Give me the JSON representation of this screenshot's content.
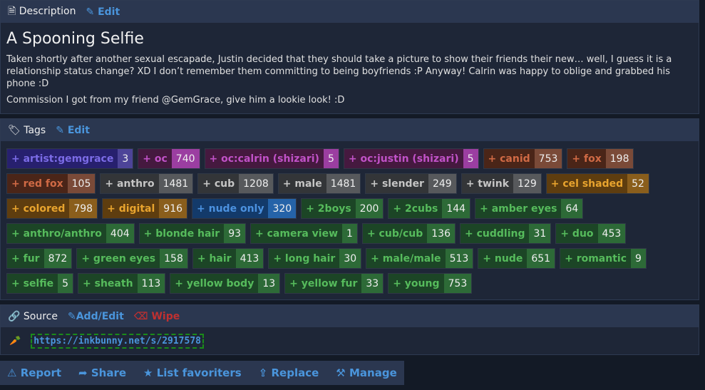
{
  "description": {
    "header": "Description",
    "edit": "Edit",
    "title": "A Spooning Selfie",
    "paragraphs": [
      "Taken shortly after another sexual escapade, Justin decided that they should take a picture to show their friends their new… well, I guess it is a relationship status change? XD I don’t remember them committing to being boyfriends :P Anyway! Calrin was happy to oblige and grabbed his phone :D",
      "Commission I got from my friend @GemGrace, give him a lookie look! :D"
    ]
  },
  "tags": {
    "header": "Tags",
    "edit": "Edit",
    "items": [
      {
        "name": "+ artist:gemgrace",
        "count": "3",
        "type": "artist"
      },
      {
        "name": "+ oc",
        "count": "740",
        "type": "character"
      },
      {
        "name": "+ oc:calrin (shizari)",
        "count": "5",
        "type": "character"
      },
      {
        "name": "+ oc:justin (shizari)",
        "count": "5",
        "type": "character"
      },
      {
        "name": "+ canid",
        "count": "753",
        "type": "species"
      },
      {
        "name": "+ fox",
        "count": "198",
        "type": "species"
      },
      {
        "name": "+ red fox",
        "count": "105",
        "type": "species"
      },
      {
        "name": "+ anthro",
        "count": "1481",
        "type": "general"
      },
      {
        "name": "+ cub",
        "count": "1208",
        "type": "general"
      },
      {
        "name": "+ male",
        "count": "1481",
        "type": "general"
      },
      {
        "name": "+ slender",
        "count": "249",
        "type": "general"
      },
      {
        "name": "+ twink",
        "count": "129",
        "type": "general"
      },
      {
        "name": "+ cel shaded",
        "count": "52",
        "type": "meta"
      },
      {
        "name": "+ colored",
        "count": "798",
        "type": "meta"
      },
      {
        "name": "+ digital",
        "count": "916",
        "type": "meta"
      },
      {
        "name": "+ nude only",
        "count": "320",
        "type": "copy"
      },
      {
        "name": "+ 2boys",
        "count": "200",
        "type": "gen"
      },
      {
        "name": "+ 2cubs",
        "count": "144",
        "type": "gen"
      },
      {
        "name": "+ amber eyes",
        "count": "64",
        "type": "gen"
      },
      {
        "name": "+ anthro/anthro",
        "count": "404",
        "type": "gen"
      },
      {
        "name": "+ blonde hair",
        "count": "93",
        "type": "gen"
      },
      {
        "name": "+ camera view",
        "count": "1",
        "type": "gen"
      },
      {
        "name": "+ cub/cub",
        "count": "136",
        "type": "gen"
      },
      {
        "name": "+ cuddling",
        "count": "31",
        "type": "gen"
      },
      {
        "name": "+ duo",
        "count": "453",
        "type": "gen"
      },
      {
        "name": "+ fur",
        "count": "872",
        "type": "gen"
      },
      {
        "name": "+ green eyes",
        "count": "158",
        "type": "gen"
      },
      {
        "name": "+ hair",
        "count": "413",
        "type": "gen"
      },
      {
        "name": "+ long hair",
        "count": "30",
        "type": "gen"
      },
      {
        "name": "+ male/male",
        "count": "513",
        "type": "gen"
      },
      {
        "name": "+ nude",
        "count": "651",
        "type": "gen"
      },
      {
        "name": "+ romantic",
        "count": "9",
        "type": "gen"
      },
      {
        "name": "+ selfie",
        "count": "5",
        "type": "gen"
      },
      {
        "name": "+ sheath",
        "count": "113",
        "type": "gen"
      },
      {
        "name": "+ yellow body",
        "count": "13",
        "type": "gen"
      },
      {
        "name": "+ yellow fur",
        "count": "33",
        "type": "gen"
      },
      {
        "name": "+ young",
        "count": "753",
        "type": "gen"
      }
    ]
  },
  "source": {
    "header": "Source",
    "add_edit": "Add/Edit",
    "wipe": "Wipe",
    "url": "https://inkbunny.net/s/2917578"
  },
  "actions": {
    "report": "Report",
    "share": "Share",
    "list_favoriters": "List favoriters",
    "replace": "Replace",
    "manage": "Manage"
  }
}
